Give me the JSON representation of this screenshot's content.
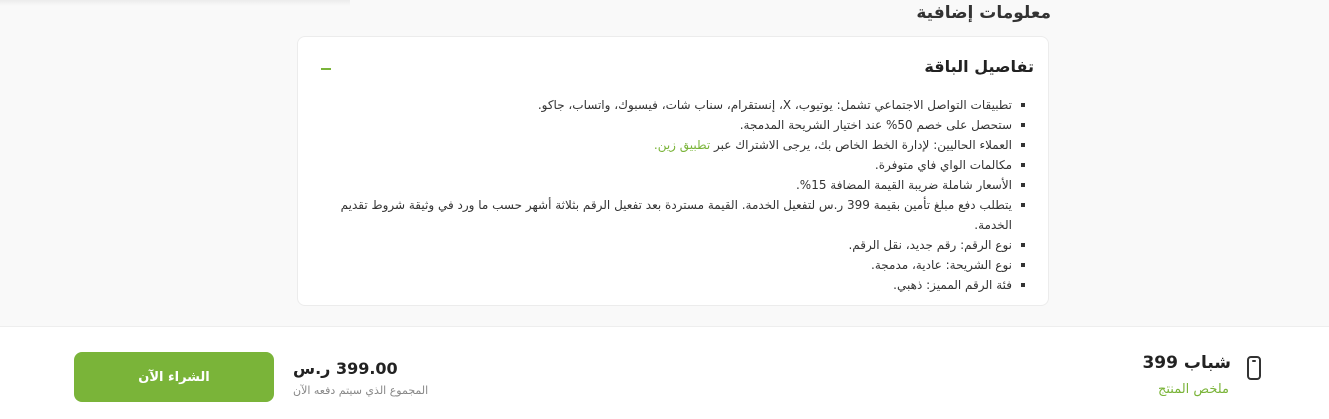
{
  "section": {
    "title": "معلومات إضافية"
  },
  "package": {
    "header": "تفاصيل الباقة",
    "details": [
      "تطبيقات التواصل الاجتماعي تشمل: يوتيوب، X، إنستقرام، سناب شات، فيسبوك، واتساب، جاكو.",
      "ستحصل على خصم 50% عند اختيار الشريحة المدمجة.",
      "العملاء الحاليين: لإدارة الخط الخاص بك، يرجى الاشتراك عبر",
      "مكالمات الواي فاي متوفرة.",
      "الأسعار شاملة ضريبة القيمة المضافة 15%.",
      "يتطلب دفع مبلغ تأمين بقيمة 399 ر.س لتفعيل الخدمة. القيمة مستردة بعد تفعيل الرقم بثلاثة أشهر حسب ما ورد في وثيقة شروط تقديم الخدمة.",
      "نوع الرقم: رقم جديد، نقل الرقم.",
      "نوع الشريحة: عادية، مدمجة.",
      "فئة الرقم المميز: ذهبي."
    ],
    "app_link": "تطبيق زين."
  },
  "summary": {
    "plan_name": "شباب 399",
    "label": "ملخص المنتج",
    "total_amount": "399.00 ر.س",
    "total_label": "المجموع الذي سيتم دفعه الآن",
    "buy_button": "الشراء الآن"
  },
  "colors": {
    "accent": "#7ab439"
  },
  "icons": {
    "collapse": "minus-icon",
    "device": "phone-icon"
  }
}
